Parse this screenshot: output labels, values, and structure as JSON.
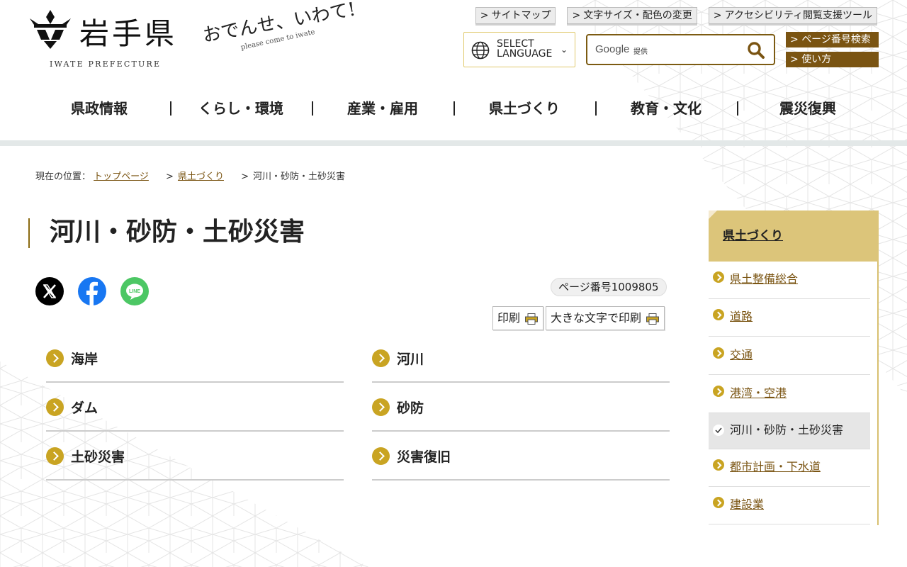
{
  "header": {
    "logo_jp": "岩手県",
    "logo_en": "IWATE PREFECTURE",
    "catch_main": "おでんせ、いわて!",
    "catch_sub": "please come to iwate",
    "util_links": [
      "サイトマップ",
      "文字サイズ・配色の変更",
      "アクセシビリティ閲覧支援ツール"
    ],
    "language": {
      "label_line1": "SELECT",
      "label_line2": "LANGUAGE"
    },
    "search": {
      "brand": "Google",
      "provided": "提供",
      "placeholder": ""
    },
    "page_number_search": "ページ番号検索",
    "how_to_use": "使い方"
  },
  "global_nav": [
    "県政情報",
    "くらし・環境",
    "産業・雇用",
    "県土づくり",
    "教育・文化",
    "震災復興"
  ],
  "breadcrumb": {
    "prefix": "現在の位置：",
    "items": [
      "トップページ",
      "県土づくり"
    ],
    "current": "河川・砂防・土砂災害"
  },
  "main": {
    "title": "河川・砂防・土砂災害",
    "share": [
      "X",
      "Facebook",
      "LINE"
    ],
    "page_number": "ページ番号1009805",
    "print": "印刷",
    "print_large": "大きな文字で印刷",
    "links": [
      "海岸",
      "河川",
      "ダム",
      "砂防",
      "土砂災害",
      "災害復旧"
    ]
  },
  "side_nav": {
    "heading": "県土づくり",
    "items": [
      "県土整備総合",
      "道路",
      "交通",
      "港湾・空港",
      "河川・砂防・土砂災害",
      "都市計画・下水道",
      "建設業"
    ],
    "current_index": 4
  },
  "colors": {
    "brand_gold": "#c9a422",
    "dark_gold": "#7a5412",
    "side_head": "#dcc57a"
  },
  "icons": [
    "globe-icon",
    "search-icon",
    "x-icon",
    "facebook-icon",
    "line-icon",
    "printer-icon",
    "check-icon",
    "chevron-right-icon"
  ]
}
